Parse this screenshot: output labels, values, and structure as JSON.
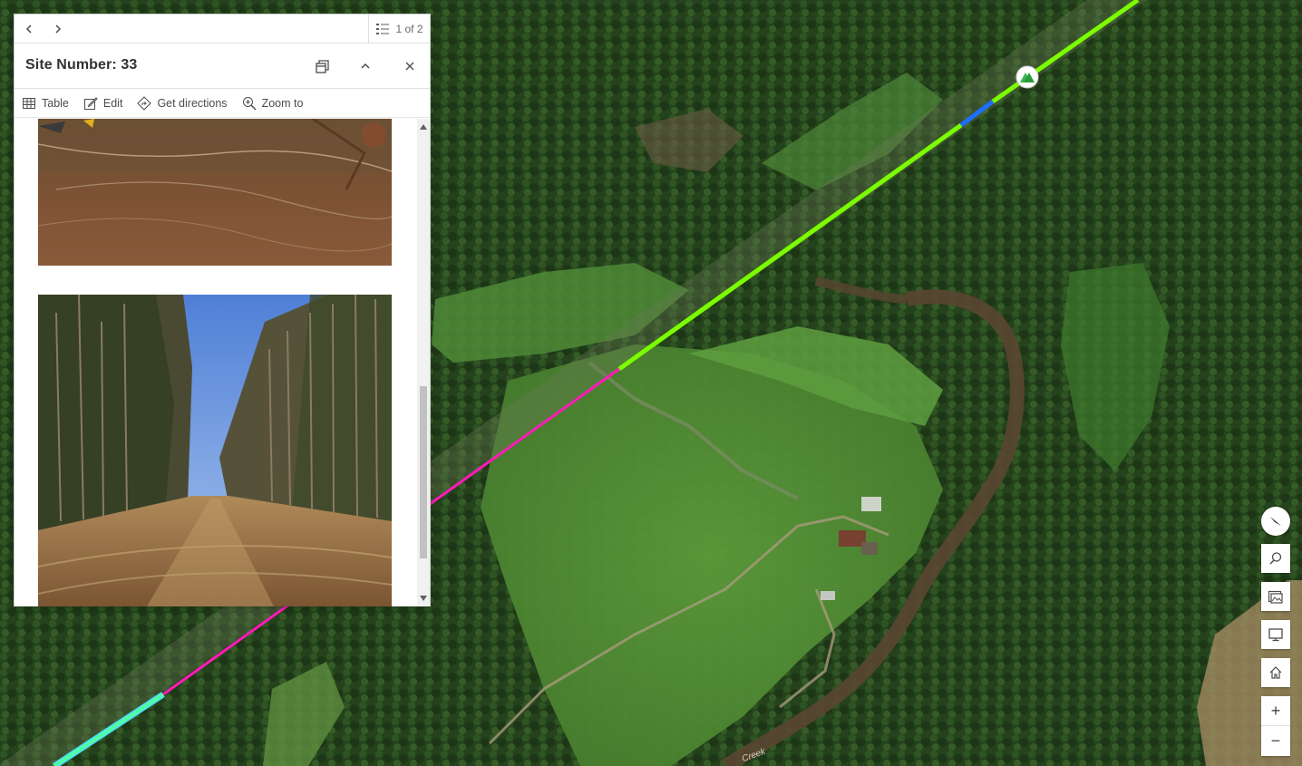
{
  "popup": {
    "pager_text": "1 of 2",
    "title": "Site Number: 33",
    "actions": [
      {
        "label": "Table",
        "icon": "table-icon"
      },
      {
        "label": "Edit",
        "icon": "edit-icon"
      },
      {
        "label": "Get directions",
        "icon": "directions-icon"
      },
      {
        "label": "Zoom to",
        "icon": "zoom-to-icon"
      }
    ],
    "photos": [
      "cleared-ground-photo",
      "cleared-corridor-photo"
    ]
  },
  "map": {
    "label": "Creek",
    "route_colors": {
      "primary": "#7cfc00",
      "selected": "#1e6fff",
      "alt": "#ff1ab8",
      "highlight": "#50ffa0"
    },
    "controls": [
      "compass-button",
      "search-button",
      "basemap-button",
      "fullscreen-button",
      "home-button",
      "zoom-in-button",
      "zoom-out-button"
    ],
    "zoom_in": "+",
    "zoom_out": "−"
  }
}
